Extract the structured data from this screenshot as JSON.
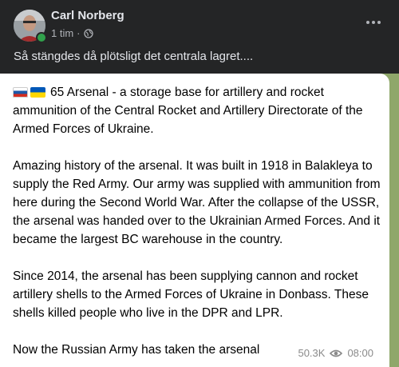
{
  "post": {
    "author": "Carl Norberg",
    "time": "1 tim",
    "separator": "·",
    "caption": "Så stängdes då plötsligt det centrala lagret...."
  },
  "telegram": {
    "paragraphs": [
      "65 Arsenal - a storage base for artillery and rocket ammunition of the Central Rocket and Artillery Directorate of the Armed Forces of Ukraine.",
      "Amazing history of the arsenal. It was built in 1918 in Balakleya to supply the Red Army. Our army was supplied with ammunition from here during the Second World War. After the collapse of the USSR, the arsenal was handed over to the Ukrainian Armed Forces. And it became the largest BC warehouse in the country.",
      "Since 2014, the arsenal has been supplying cannon and rocket artillery shells to the Armed Forces of Ukraine in Donbass. These shells killed people who live in the DPR and LPR.",
      "Now the Russian Army has taken the arsenal"
    ],
    "views": "50.3K",
    "timestamp": "08:00"
  },
  "icons": {
    "privacy": "globe-icon",
    "views": "eye-icon",
    "more": "more-options-icon",
    "flags": [
      "russia-flag-icon",
      "ukraine-flag-icon"
    ]
  },
  "colors": {
    "background": "#242526",
    "text": "#e4e6eb",
    "secondary_text": "#b0b3b8",
    "online": "#31a24c",
    "telegram_background": "#8fa76a"
  }
}
